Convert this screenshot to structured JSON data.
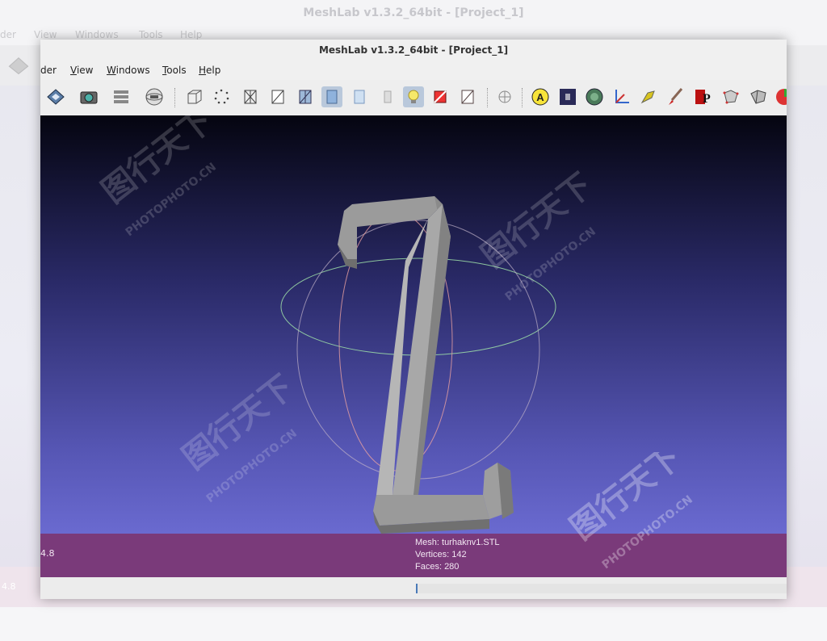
{
  "background_window": {
    "title": "MeshLab v1.3.2_64bit - [Project_1]",
    "menu": [
      "der",
      "View",
      "Windows",
      "Tools",
      "Help"
    ],
    "status_value": "4.8"
  },
  "window": {
    "title": "MeshLab v1.3.2_64bit - [Project_1]"
  },
  "menu": {
    "items": [
      {
        "label": "der"
      },
      {
        "label": "View"
      },
      {
        "label": "Windows"
      },
      {
        "label": "Tools"
      },
      {
        "label": "Help"
      }
    ]
  },
  "toolbar": {
    "buttons": [
      {
        "name": "open-layer-icon"
      },
      {
        "name": "snapshot-icon"
      },
      {
        "name": "layers-icon"
      },
      {
        "name": "trackball-icon"
      },
      {
        "name": "bbox-icon"
      },
      {
        "name": "points-icon"
      },
      {
        "name": "wireframe-icon"
      },
      {
        "name": "hidden-lines-icon"
      },
      {
        "name": "flat-lines-icon"
      },
      {
        "name": "flat-shading-icon"
      },
      {
        "name": "smooth-shading-icon"
      },
      {
        "name": "texture-icon"
      },
      {
        "name": "light-icon"
      },
      {
        "name": "double-side-lighting-icon"
      },
      {
        "name": "back-face-icon"
      },
      {
        "name": "selection-icon"
      },
      {
        "name": "annotation-icon"
      },
      {
        "name": "layer-dialog-icon"
      },
      {
        "name": "color-icon"
      },
      {
        "name": "measure-icon"
      },
      {
        "name": "align-icon"
      },
      {
        "name": "paint-icon"
      },
      {
        "name": "pick-points-icon"
      },
      {
        "name": "select-vertex-icon"
      },
      {
        "name": "select-connected-icon"
      },
      {
        "name": "sphere-icon"
      }
    ],
    "active_indices": [
      9,
      12
    ]
  },
  "viewport": {
    "fps": "4.8",
    "mesh_label": "Mesh: turhaknv1.STL",
    "vertices_label": "Vertices: 142",
    "faces_label": "Faces: 280"
  },
  "watermark": {
    "cn": "图行天下",
    "en": "PHOTOPHOTO.CN"
  },
  "colors": {
    "viewport_top": "#050510",
    "viewport_bottom": "#6a6ad0",
    "info_bar": "#7a3a7a",
    "mesh": "#9a9a9a"
  }
}
